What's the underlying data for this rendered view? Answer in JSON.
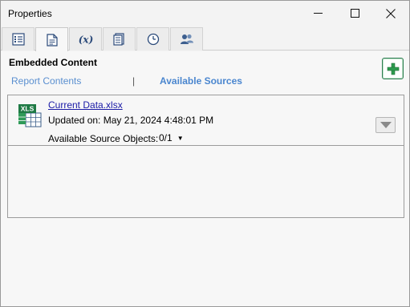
{
  "window": {
    "title": "Properties"
  },
  "tabs": [
    {
      "icon": "list-icon",
      "active": false
    },
    {
      "icon": "document-icon",
      "active": true
    },
    {
      "icon": "variable-icon",
      "label": "(x)",
      "active": false
    },
    {
      "icon": "report-icon",
      "active": false
    },
    {
      "icon": "clock-icon",
      "active": false
    },
    {
      "icon": "users-icon",
      "active": false
    }
  ],
  "section": {
    "title": "Embedded Content"
  },
  "subtabs": {
    "report": "Report Contents",
    "separator": "|",
    "available": "Available Sources"
  },
  "source": {
    "badge": "XLS",
    "file_name": "Current Data.xlsx",
    "updated": "Updated on: May 21, 2024 4:48:01 PM",
    "objects_label": "Available Source Objects:",
    "objects_value": "0/1"
  },
  "colors": {
    "link": "#1a1aa6",
    "subtab": "#5a8fd0",
    "add_green": "#2e9b4f",
    "excel_green": "#1f7a45"
  }
}
